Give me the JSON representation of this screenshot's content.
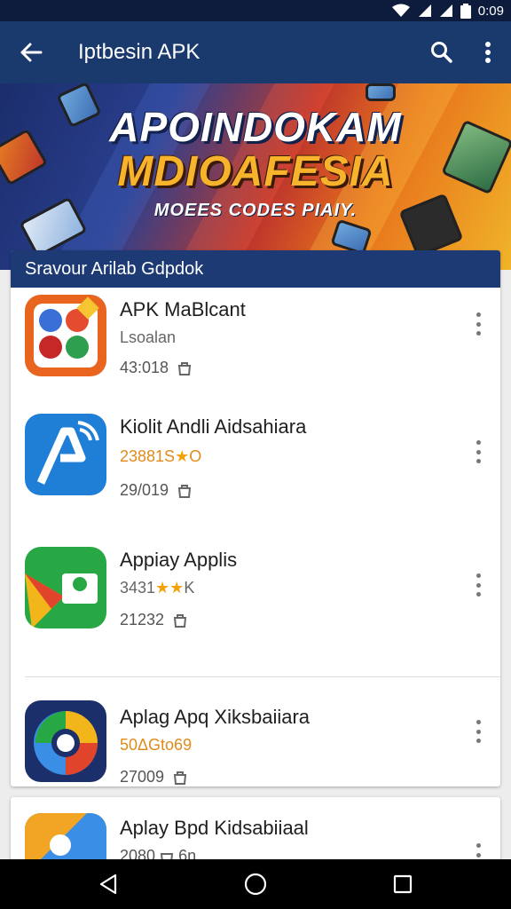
{
  "status_bar": {
    "time": "0:09"
  },
  "app_bar": {
    "title": "Iptbesin APK"
  },
  "banner": {
    "line1": "APOINDOKAM",
    "line2": "MDIOAFESIA",
    "line3": "MOEES CODES PIAIY."
  },
  "list": {
    "header": "Sravour Arilab Gdpdok",
    "apps": [
      {
        "name": "APK MaBlcant",
        "sub": "Lsoalan",
        "meta": "43:018"
      },
      {
        "name": "Kiolit Andli Aidsahiara",
        "sub": "23881S",
        "sub_suffix": "O",
        "meta": "29/019"
      },
      {
        "name": "Appiay Applis",
        "sub": "3431",
        "sub_suffix": "K",
        "meta": "21232"
      },
      {
        "name": "Aplag Apq Xiksbaiiara",
        "sub": "50ΔGto69",
        "meta": "27009"
      },
      {
        "name": "Aplay Bpd Kidsabiiaal",
        "sub": "2080",
        "sub_suffix": "6n",
        "meta": ""
      }
    ]
  },
  "colors": {
    "app_bar": "#1a3a6e",
    "card_header": "#1d3a75",
    "rating": "#e08b1b"
  }
}
